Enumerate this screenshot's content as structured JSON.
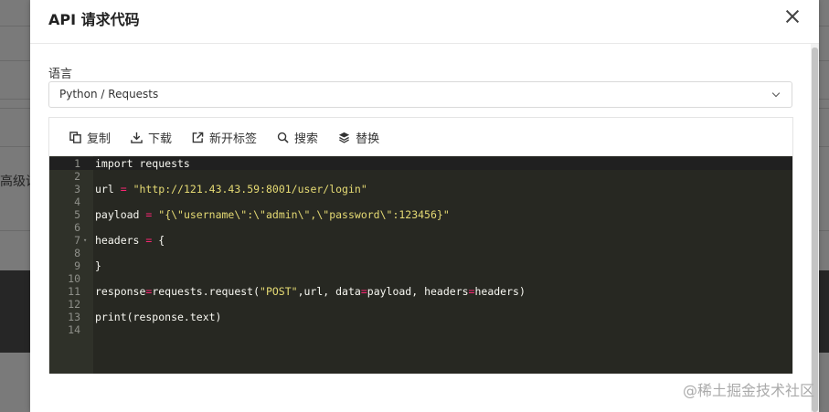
{
  "background": {
    "partial_text": "高级设"
  },
  "modal": {
    "title": "API 请求代码",
    "close_icon": "close-icon",
    "language_label": "语言",
    "language_value": "Python / Requests",
    "toolbar": [
      {
        "label": "复制",
        "icon": "copy-icon"
      },
      {
        "label": "下载",
        "icon": "download-icon"
      },
      {
        "label": "新开标签",
        "icon": "external-link-icon"
      },
      {
        "label": "搜索",
        "icon": "search-icon"
      },
      {
        "label": "替换",
        "icon": "layers-icon"
      }
    ],
    "code_lines": [
      {
        "num": "1",
        "text": "import requests"
      },
      {
        "num": "2",
        "text": ""
      },
      {
        "num": "3",
        "text": "url = \"http://121.43.43.59:8001/user/login\""
      },
      {
        "num": "4",
        "text": ""
      },
      {
        "num": "5",
        "text": "payload = \"{\\\"username\\\":\\\"admin\\\",\\\"password\\\":123456}\""
      },
      {
        "num": "6",
        "text": ""
      },
      {
        "num": "7",
        "text": "headers = {"
      },
      {
        "num": "8",
        "text": ""
      },
      {
        "num": "9",
        "text": "}"
      },
      {
        "num": "10",
        "text": ""
      },
      {
        "num": "11",
        "text": "response=requests.request(\"POST\",url, data=payload, headers=headers)"
      },
      {
        "num": "12",
        "text": ""
      },
      {
        "num": "13",
        "text": "print(response.text)"
      },
      {
        "num": "14",
        "text": ""
      }
    ]
  },
  "watermark": "@稀土掘金技术社区",
  "colors": {
    "editor_bg": "#272822",
    "string": "#e6db74",
    "operator": "#f92672",
    "text": "#f8f8f2"
  }
}
